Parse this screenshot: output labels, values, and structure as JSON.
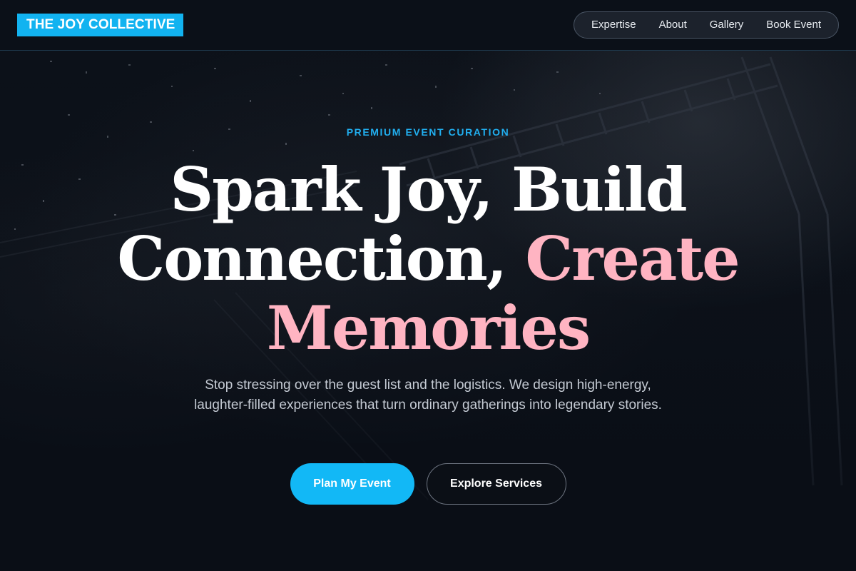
{
  "brand": {
    "name": "THE JOY COLLECTIVE",
    "color": "#12b3f0"
  },
  "nav": {
    "items": [
      {
        "label": "Expertise"
      },
      {
        "label": "About"
      },
      {
        "label": "Gallery"
      },
      {
        "label": "Book Event"
      }
    ]
  },
  "hero": {
    "eyebrow": "PREMIUM EVENT CURATION",
    "headline": {
      "line1": "Spark Joy, Build",
      "line2_white": "Connection, ",
      "line2_pink": "Create",
      "line3_pink": "Memories"
    },
    "subtitle": "Stop stressing over the guest list and the logistics. We design high-energy, laughter-filled experiences that turn ordinary gatherings into legendary stories.",
    "primary_cta": "Plan My Event",
    "secondary_cta": "Explore Services"
  },
  "colors": {
    "accent": "#12b8f6",
    "highlight": "#ffb4c2",
    "background": "#0b0f17"
  }
}
